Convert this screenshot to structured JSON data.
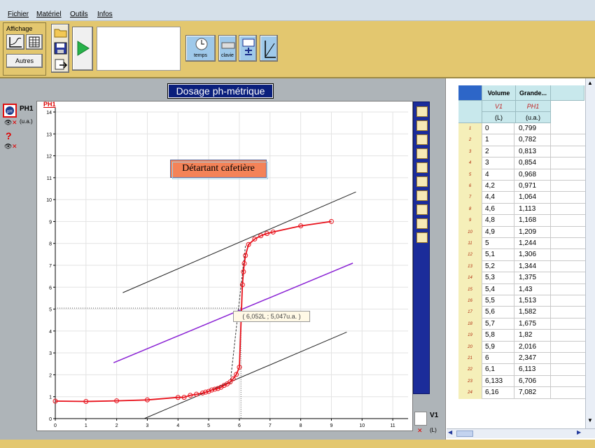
{
  "menu": [
    "Fichier",
    "Matériel",
    "Outils",
    "Infos"
  ],
  "toolbar": {
    "affichage_label": "Affichage",
    "autres_label": "Autres",
    "temps_label": "temps",
    "clavie_label": "clavie"
  },
  "graph": {
    "title": "Dosage ph-métrique",
    "y_channel_label": "PH1",
    "y_unit_label": "(u.a.)",
    "plot_corner_label": "PH1",
    "x_channel_label": "V1",
    "x_unit_label": "(L)",
    "annotation": "Détartant cafetière",
    "tooltip": "( 6,052L ; 5,047u.a. )"
  },
  "table": {
    "col1_header": "Volume",
    "col2_header": "Grande...",
    "col1_symbol": "V1",
    "col2_symbol": "PH1",
    "col1_unit": "(L)",
    "col2_unit": "(u.a.)"
  },
  "chart_data": {
    "type": "scatter",
    "xlabel": "",
    "ylabel": "PH1",
    "xlim": [
      0,
      11.5
    ],
    "ylim": [
      0,
      14
    ],
    "x_ticks": [
      0,
      1,
      2,
      3,
      4,
      5,
      6,
      7,
      8,
      9,
      10,
      11
    ],
    "y_ticks": [
      0,
      1,
      2,
      3,
      4,
      5,
      6,
      7,
      8,
      9,
      10,
      11,
      12,
      13,
      14
    ],
    "grid": true,
    "series": [
      {
        "color": "#e8101a",
        "x": [
          0,
          1,
          2,
          3,
          4,
          4.2,
          4.4,
          4.6,
          4.8,
          4.9,
          5,
          5.1,
          5.2,
          5.3,
          5.4,
          5.5,
          5.6,
          5.7,
          5.8,
          5.9,
          6,
          6.1,
          6.133,
          6.16,
          6.2,
          6.3,
          6.5,
          6.7,
          6.9,
          7.1,
          8,
          9
        ],
        "y": [
          0.799,
          0.782,
          0.813,
          0.854,
          0.968,
          0.971,
          1.064,
          1.113,
          1.168,
          1.209,
          1.244,
          1.306,
          1.344,
          1.375,
          1.43,
          1.513,
          1.582,
          1.675,
          1.82,
          2.016,
          2.347,
          6.113,
          6.706,
          7.082,
          7.45,
          7.95,
          8.2,
          8.35,
          8.45,
          8.52,
          8.8,
          9.0
        ]
      }
    ],
    "lines": [
      {
        "color": "#222222",
        "x": [
          2.2,
          9.8
        ],
        "y": [
          5.75,
          10.35
        ]
      },
      {
        "color": "#222222",
        "x": [
          2.9,
          9.5
        ],
        "y": [
          0,
          3.95
        ]
      },
      {
        "color": "#8a22d4",
        "x": [
          1.9,
          9.7
        ],
        "y": [
          2.55,
          7.1
        ]
      },
      {
        "color": "#333333",
        "x": [
          5.7,
          6.2
        ],
        "y": [
          1.6,
          7.9
        ]
      }
    ],
    "marker": {
      "x": 6.052,
      "y": 5.047
    },
    "table_rows": [
      {
        "i": "1",
        "v": "0",
        "ph": "0,799"
      },
      {
        "i": "2",
        "v": "1",
        "ph": "0,782"
      },
      {
        "i": "3",
        "v": "2",
        "ph": "0,813"
      },
      {
        "i": "4",
        "v": "3",
        "ph": "0,854"
      },
      {
        "i": "5",
        "v": "4",
        "ph": "0,968"
      },
      {
        "i": "6",
        "v": "4,2",
        "ph": "0,971"
      },
      {
        "i": "7",
        "v": "4,4",
        "ph": "1,064"
      },
      {
        "i": "8",
        "v": "4,6",
        "ph": "1,113"
      },
      {
        "i": "9",
        "v": "4,8",
        "ph": "1,168"
      },
      {
        "i": "10",
        "v": "4,9",
        "ph": "1,209"
      },
      {
        "i": "11",
        "v": "5",
        "ph": "1,244"
      },
      {
        "i": "12",
        "v": "5,1",
        "ph": "1,306"
      },
      {
        "i": "13",
        "v": "5,2",
        "ph": "1,344"
      },
      {
        "i": "14",
        "v": "5,3",
        "ph": "1,375"
      },
      {
        "i": "15",
        "v": "5,4",
        "ph": "1,43"
      },
      {
        "i": "16",
        "v": "5,5",
        "ph": "1,513"
      },
      {
        "i": "17",
        "v": "5,6",
        "ph": "1,582"
      },
      {
        "i": "18",
        "v": "5,7",
        "ph": "1,675"
      },
      {
        "i": "19",
        "v": "5,8",
        "ph": "1,82"
      },
      {
        "i": "20",
        "v": "5,9",
        "ph": "2,016"
      },
      {
        "i": "21",
        "v": "6",
        "ph": "2,347"
      },
      {
        "i": "22",
        "v": "6,1",
        "ph": "6,113"
      },
      {
        "i": "23",
        "v": "6,133",
        "ph": "6,706"
      },
      {
        "i": "24",
        "v": "6,16",
        "ph": "7,082"
      }
    ]
  }
}
